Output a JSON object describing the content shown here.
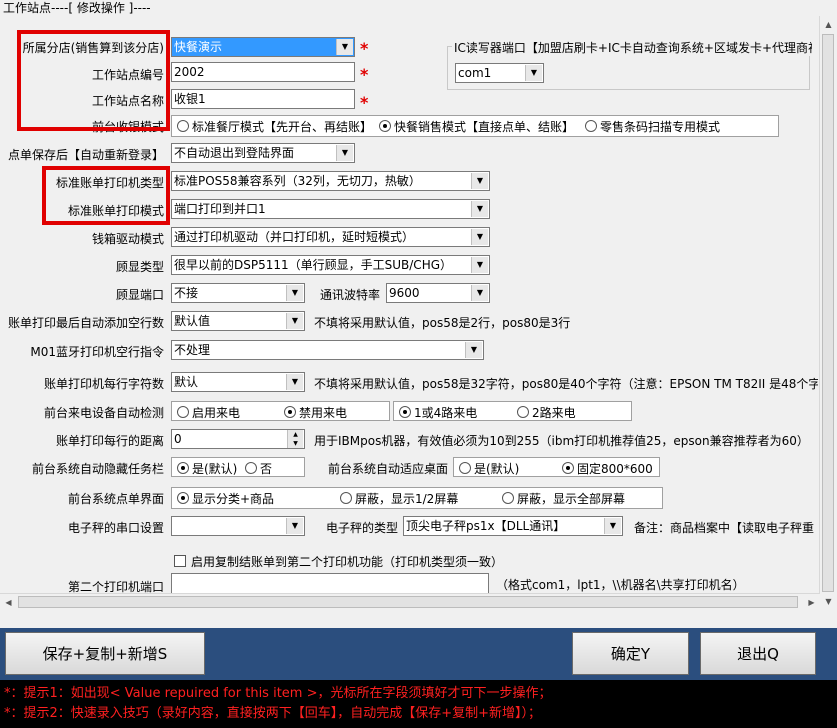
{
  "window": {
    "title": "工作站点----[ 修改操作 ]----"
  },
  "fields": {
    "branch": {
      "label": "所属分店(销售算到该分店)",
      "value": "快餐演示"
    },
    "station_no": {
      "label": "工作站点编号",
      "value": "2002"
    },
    "station_name": {
      "label": "工作站点名称",
      "value": "收银1"
    },
    "pos_mode": {
      "label": "前台收银模式",
      "options": [
        "标准餐厅模式【先开台、再结账】",
        "快餐销售模式【直接点单、结账】",
        "零售条码扫描专用模式"
      ],
      "selected": 1
    },
    "after_save": {
      "label": "点单保存后【自动重新登录】",
      "value": "不自动退出到登陆界面"
    },
    "printer_type": {
      "label": "标准账单打印机类型",
      "value": "标准POS58兼容系列（32列，无切刀，热敏）"
    },
    "print_mode": {
      "label": "标准账单打印模式",
      "value": "端口打印到并口1"
    },
    "cashbox": {
      "label": "钱箱驱动模式",
      "value": "通过打印机驱动（并口打印机，延时短模式）"
    },
    "display_type": {
      "label": "顾显类型",
      "value": "很早以前的DSP5111（单行顾显，手工SUB/CHG）"
    },
    "display_port": {
      "label": "顾显端口",
      "value": "不接"
    },
    "baud": {
      "label": "通讯波特率",
      "value": "9600"
    },
    "blank_lines": {
      "label": "账单打印最后自动添加空行数",
      "value": "默认值",
      "note": "不填将采用默认值，pos58是2行，pos80是3行"
    },
    "m01": {
      "label": "M01蓝牙打印机空行指令",
      "value": "不处理"
    },
    "chars_per_line": {
      "label": "账单打印机每行字符数",
      "value": "默认",
      "note": "不填将采用默认值，pos58是32字符，pos80是40个字符（注意：EPSON TM T82II 是48个字"
    },
    "caller_detect": {
      "label": "前台来电设备自动检测",
      "options": [
        "启用来电",
        "禁用来电"
      ],
      "selected": 1,
      "ports": [
        "1或4路来电",
        "2路来电"
      ],
      "port_selected": 0
    },
    "line_distance": {
      "label": "账单打印每行的距离",
      "value": "0",
      "note": "用于IBMpos机器，有效值必须为10到255（ibm打印机推荐值25，epson兼容推荐者为60）"
    },
    "hide_taskbar": {
      "label": "前台系统自动隐藏任务栏",
      "options": [
        "是(默认)",
        "否"
      ],
      "selected": 0
    },
    "adapt_desktop": {
      "label": "前台系统自动适应桌面",
      "options": [
        "是(默认)",
        "固定800*600"
      ],
      "selected": 1
    },
    "order_ui": {
      "label": "前台系统点单界面",
      "options": [
        "显示分类+商品",
        "屏蔽，显示1/2屏幕",
        "屏蔽，显示全部屏幕"
      ],
      "selected": 0
    },
    "scale_port": {
      "label": "电子秤的串口设置",
      "value": ""
    },
    "scale_type": {
      "label": "电子秤的类型",
      "value": "顶尖电子秤ps1x【DLL通讯】",
      "note": "备注：商品档案中【读取电子秤重"
    },
    "copy_print": {
      "label": "启用复制结账单到第二个打印机功能（打印机类型须一致）"
    },
    "second_port": {
      "label": "第二个打印机端口",
      "value": "",
      "note": "（格式com1，lpt1，\\\\机器名\\共享打印机名）"
    }
  },
  "ic_reader": {
    "title": "IC读写器端口【加盟店刷卡+IC卡自动查询系统+区域发卡+代理商初",
    "value": "com1"
  },
  "buttons": {
    "save_copy_new": "保存+复制+新增S",
    "ok": "确定Y",
    "exit": "退出Q"
  },
  "tips": {
    "line1": "*：提示1：如出现< Value repuired for this item >，光标所在字段须填好才可下一步操作；",
    "line2": "*：提示2：快速录入技巧（录好内容，直接按两下【回车】，自动完成【保存+复制+新增】）；"
  },
  "required_mark": "*",
  "colors": {
    "highlight_box": "#e00000",
    "selection": "#3399ff",
    "button_bar": "#2b4e7e",
    "tips_text": "#ff2020"
  }
}
